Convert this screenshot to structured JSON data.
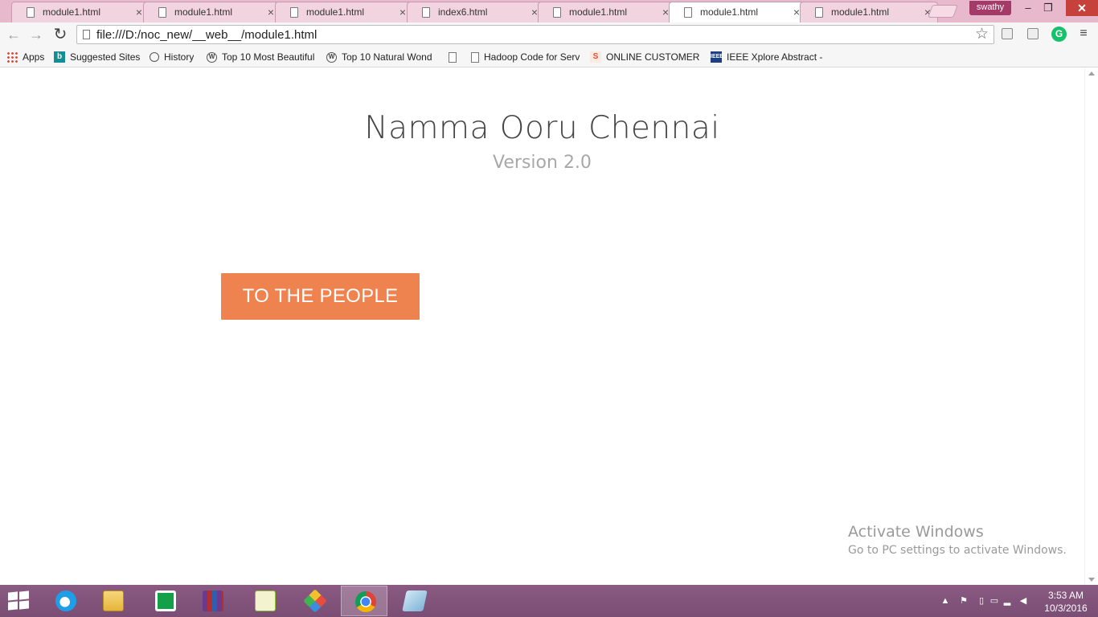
{
  "browser": {
    "tabs": [
      {
        "title": "module1.html",
        "active": false
      },
      {
        "title": "module1.html",
        "active": false
      },
      {
        "title": "module1.html",
        "active": false
      },
      {
        "title": "index6.html",
        "active": false
      },
      {
        "title": "module1.html",
        "active": false
      },
      {
        "title": "module1.html",
        "active": true
      },
      {
        "title": "module1.html",
        "active": false
      }
    ],
    "tab_close_glyph": "×",
    "profile_name": "swathy",
    "window_controls": {
      "minimize": "–",
      "restore": "❐",
      "close": "✕"
    },
    "nav": {
      "back": "←",
      "forward": "→",
      "reload": "↻"
    },
    "url": "file:///D:/noc_new/__web__/module1.html",
    "star_glyph": "☆",
    "menu_glyph": "≡",
    "grammarly_label": "G",
    "bookmarks": [
      {
        "label": "Apps",
        "icon": "apps-grid-icon"
      },
      {
        "label": "Suggested Sites",
        "icon": "bing-icon",
        "glyph": "b"
      },
      {
        "label": "History",
        "icon": "history-clock-icon"
      },
      {
        "label": "Top 10 Most Beautiful",
        "icon": "wordpress-icon",
        "glyph": "W"
      },
      {
        "label": "Top 10 Natural Wond",
        "icon": "wordpress-icon",
        "glyph": "W"
      },
      {
        "label": "",
        "icon": "document-icon"
      },
      {
        "label": "Hadoop Code for Serv",
        "icon": "document-icon"
      },
      {
        "label": "ONLINE CUSTOMER E",
        "icon": "site-favicon-icon",
        "glyph": "S"
      },
      {
        "label": "IEEE Xplore Abstract -",
        "icon": "ieee-icon",
        "glyph": "IEEE"
      }
    ]
  },
  "page": {
    "title": "Namma Ooru Chennai",
    "subtitle": "Version 2.0",
    "cta_label": "TO THE PEOPLE",
    "accent_color": "#ef8350"
  },
  "watermark": {
    "title": "Activate Windows",
    "subtitle": "Go to PC settings to activate Windows."
  },
  "taskbar": {
    "apps": [
      {
        "name": "internet-explorer",
        "active": false
      },
      {
        "name": "file-explorer",
        "active": false
      },
      {
        "name": "store",
        "active": false
      },
      {
        "name": "winrar",
        "active": false
      },
      {
        "name": "notepad-plus-plus",
        "active": false
      },
      {
        "name": "git",
        "active": false
      },
      {
        "name": "chrome",
        "active": true
      },
      {
        "name": "document-app",
        "active": false
      }
    ],
    "clock_time": "3:53 AM",
    "clock_date": "10/3/2016"
  }
}
